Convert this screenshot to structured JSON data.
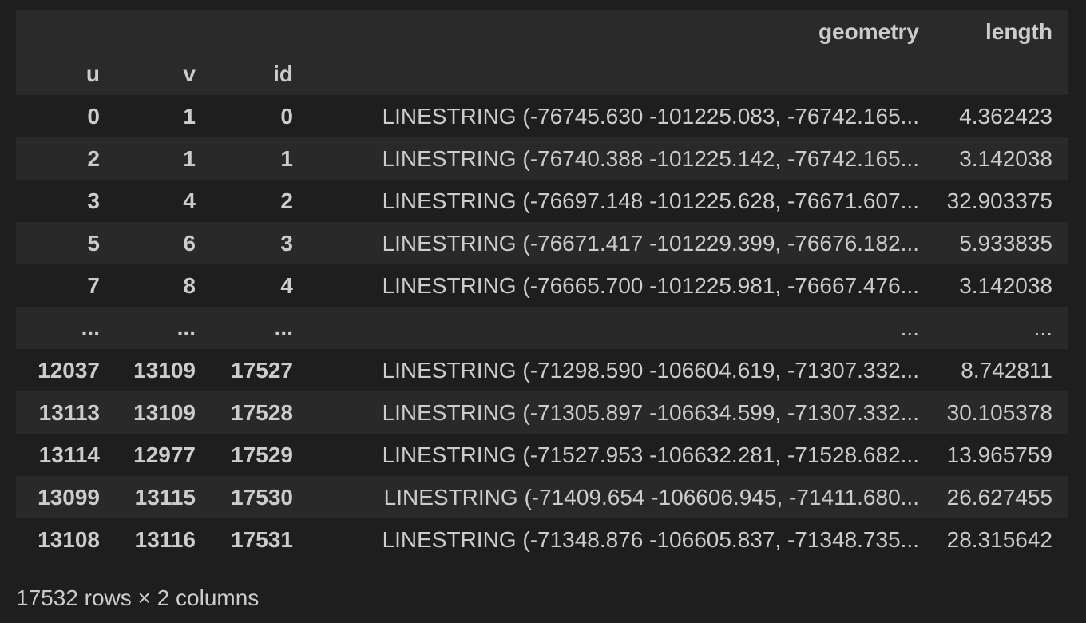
{
  "columns": {
    "top": [
      "",
      "",
      "",
      "geometry",
      "length"
    ],
    "index_names": [
      "u",
      "v",
      "id",
      "",
      ""
    ]
  },
  "rows": [
    {
      "u": "0",
      "v": "1",
      "id": "0",
      "geometry": "LINESTRING (-76745.630 -101225.083, -76742.165...",
      "length": "4.362423"
    },
    {
      "u": "2",
      "v": "1",
      "id": "1",
      "geometry": "LINESTRING (-76740.388 -101225.142, -76742.165...",
      "length": "3.142038"
    },
    {
      "u": "3",
      "v": "4",
      "id": "2",
      "geometry": "LINESTRING (-76697.148 -101225.628, -76671.607...",
      "length": "32.903375"
    },
    {
      "u": "5",
      "v": "6",
      "id": "3",
      "geometry": "LINESTRING (-76671.417 -101229.399, -76676.182...",
      "length": "5.933835"
    },
    {
      "u": "7",
      "v": "8",
      "id": "4",
      "geometry": "LINESTRING (-76665.700 -101225.981, -76667.476...",
      "length": "3.142038"
    },
    {
      "u": "...",
      "v": "...",
      "id": "...",
      "geometry": "...",
      "length": "..."
    },
    {
      "u": "12037",
      "v": "13109",
      "id": "17527",
      "geometry": "LINESTRING (-71298.590 -106604.619, -71307.332...",
      "length": "8.742811"
    },
    {
      "u": "13113",
      "v": "13109",
      "id": "17528",
      "geometry": "LINESTRING (-71305.897 -106634.599, -71307.332...",
      "length": "30.105378"
    },
    {
      "u": "13114",
      "v": "12977",
      "id": "17529",
      "geometry": "LINESTRING (-71527.953 -106632.281, -71528.682...",
      "length": "13.965759"
    },
    {
      "u": "13099",
      "v": "13115",
      "id": "17530",
      "geometry": "LINESTRING (-71409.654 -106606.945, -71411.680...",
      "length": "26.627455"
    },
    {
      "u": "13108",
      "v": "13116",
      "id": "17531",
      "geometry": "LINESTRING (-71348.876 -106605.837, -71348.735...",
      "length": "28.315642"
    }
  ],
  "footer": "17532 rows × 2 columns"
}
